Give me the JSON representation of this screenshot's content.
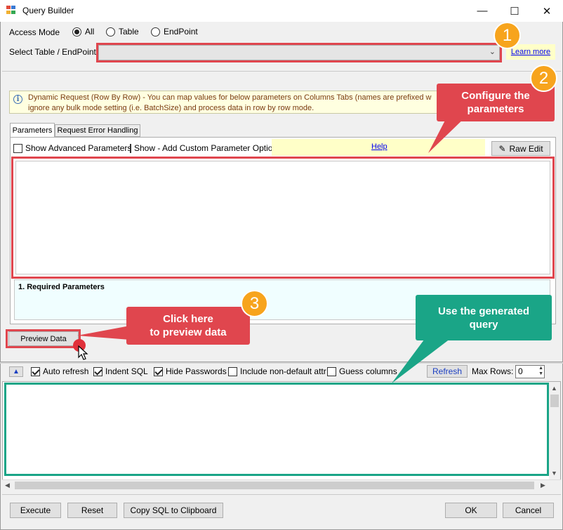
{
  "window": {
    "title": "Query Builder",
    "minimize": "—",
    "maximize": "☐",
    "close": "✕"
  },
  "access_mode": {
    "label": "Access Mode",
    "options": [
      "All",
      "Table",
      "EndPoint"
    ],
    "selected": "All"
  },
  "select_table": {
    "label": "Select Table / EndPoint",
    "value": "",
    "learn_more": "Learn more"
  },
  "info_message": "Dynamic Request (Row By Row) - You can map values for below parameters on Columns Tabs (names are prefixed w... ignore any bulk mode setting (i.e. BatchSize) and process data in row by row mode.",
  "info_line1": "Dynamic Request (Row By Row) - You can map values for below parameters on Columns Tabs (names are prefixed w",
  "info_line2": "ignore any bulk mode setting (i.e. BatchSize) and process data in row by row mode.",
  "tabs": [
    {
      "label": "Parameters",
      "active": true
    },
    {
      "label": "Request Error Handling",
      "active": false
    }
  ],
  "params_toolbar": {
    "show_advanced": "Show Advanced Parameters",
    "show_custom": "Show - Add Custom Parameter Option",
    "help": "Help",
    "raw_edit": "Raw Edit"
  },
  "required_params_label": "1. Required Parameters",
  "preview_button": "Preview Data",
  "sql_toolbar": {
    "auto_refresh": {
      "label": "Auto refresh",
      "checked": true
    },
    "indent_sql": {
      "label": "Indent SQL",
      "checked": true
    },
    "hide_passwords": {
      "label": "Hide Passwords",
      "checked": true
    },
    "include_non_default": {
      "label": "Include non-default attr",
      "checked": false
    },
    "guess_columns": {
      "label": "Guess columns",
      "checked": false
    },
    "refresh": "Refresh",
    "max_rows_label": "Max Rows:",
    "max_rows_value": "0"
  },
  "footer": {
    "execute": "Execute",
    "reset": "Reset",
    "copy_sql": "Copy SQL to Clipboard",
    "ok": "OK",
    "cancel": "Cancel"
  },
  "annotations": {
    "badge1": "1",
    "badge2": "2",
    "badge3": "3",
    "callout_configure": "Configure the parameters",
    "callout_configure_l1": "Configure the",
    "callout_configure_l2": "parameters",
    "callout_preview_l1": "Click here",
    "callout_preview_l2": "to preview data",
    "callout_query_l1": "Use the generated",
    "callout_query_l2": "query"
  },
  "colors": {
    "highlight_red": "#e0464e",
    "highlight_green": "#1aa587",
    "badge_orange": "#f7a41d",
    "info_bg": "#ffffe0"
  }
}
